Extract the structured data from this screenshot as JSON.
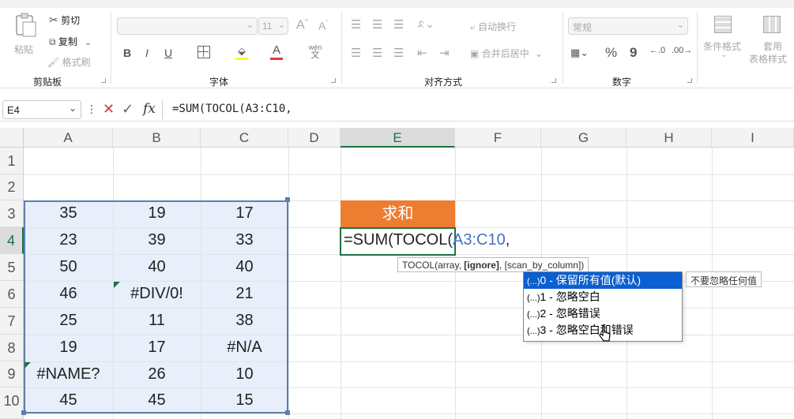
{
  "ribbon": {
    "clipboard": {
      "paste": "粘贴",
      "cut": "剪切",
      "copy": "复制",
      "format_painter": "格式刷",
      "group": "剪贴板"
    },
    "font": {
      "size": "11",
      "group": "字体",
      "bold": "B",
      "italic": "I",
      "underline": "U",
      "font_color_glyph": "A",
      "wen": "wén",
      "wen2": "文"
    },
    "align": {
      "wrap": "自动换行",
      "merge": "合并后居中",
      "group": "对齐方式"
    },
    "number": {
      "format": "常规",
      "percent": "%",
      "comma": "9",
      "group": "数字"
    },
    "styles": {
      "conditional": "条件格式",
      "table_style": "套用",
      "table_style2": "表格样式"
    }
  },
  "formula_bar": {
    "name_box": "E4",
    "formula": "=SUM(TOCOL(A3:C10,",
    "fx": "fx"
  },
  "columns": [
    "A",
    "B",
    "C",
    "D",
    "E",
    "F",
    "G",
    "H",
    "I"
  ],
  "rows": [
    "1",
    "2",
    "3",
    "4",
    "5",
    "6",
    "7",
    "8",
    "9",
    "10"
  ],
  "data": [
    [
      "35",
      "19",
      "17"
    ],
    [
      "23",
      "39",
      "33"
    ],
    [
      "50",
      "40",
      "40"
    ],
    [
      "46",
      "#DIV/0!",
      "21"
    ],
    [
      "25",
      "11",
      "38"
    ],
    [
      "19",
      "17",
      "#N/A"
    ],
    [
      "#NAME?",
      "26",
      "10"
    ],
    [
      "45",
      "45",
      "15"
    ]
  ],
  "header_cell": "求和",
  "edit_cell": {
    "prefix": "=SUM(TOCOL(",
    "ref": "A3:C10",
    "suffix": ","
  },
  "tooltip": {
    "pre": "TOCOL(array, ",
    "bold": "[ignore]",
    "post": ", [scan_by_column])"
  },
  "dropdown": {
    "badge": "(...)",
    "items": [
      "0 - 保留所有值(默认)",
      "1 - 忽略空白",
      "2 - 忽略错误",
      "3 - 忽略空白和错误"
    ],
    "side_tip": "不要忽略任何值"
  },
  "colors": {
    "accent": "#ed7d31",
    "selection": "#1e7145",
    "ref": "#4472c4",
    "range_fill": "#e8effa"
  }
}
